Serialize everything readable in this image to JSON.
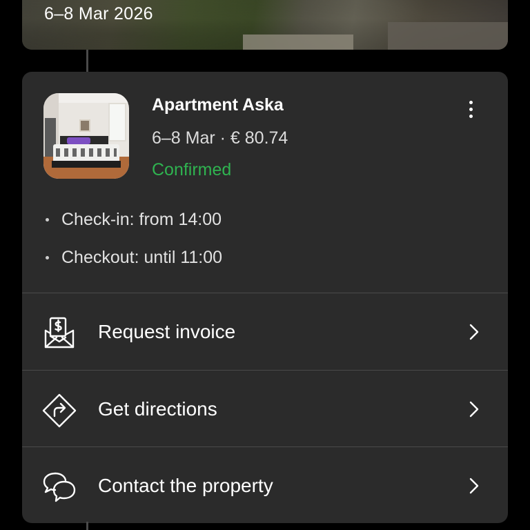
{
  "previous_stay": {
    "dates": "6–8 Mar 2026"
  },
  "booking": {
    "property_name": "Apartment Aska",
    "summary": "6–8 Mar · € 80.74",
    "status": "Confirmed",
    "status_color": "#2fb350",
    "check_in": "Check-in: from 14:00",
    "checkout": "Checkout: until 11:00",
    "thumbnail_icon": "bedroom-photo",
    "menu_icon": "more-vertical-icon"
  },
  "actions": [
    {
      "label": "Request invoice",
      "icon": "invoice-envelope-icon"
    },
    {
      "label": "Get directions",
      "icon": "directions-sign-icon"
    },
    {
      "label": "Contact the property",
      "icon": "chat-bubbles-icon"
    }
  ],
  "theme": {
    "background": "#000000",
    "card": "#2b2b2b",
    "divider": "#4a4a4a",
    "text": "#ffffff"
  }
}
